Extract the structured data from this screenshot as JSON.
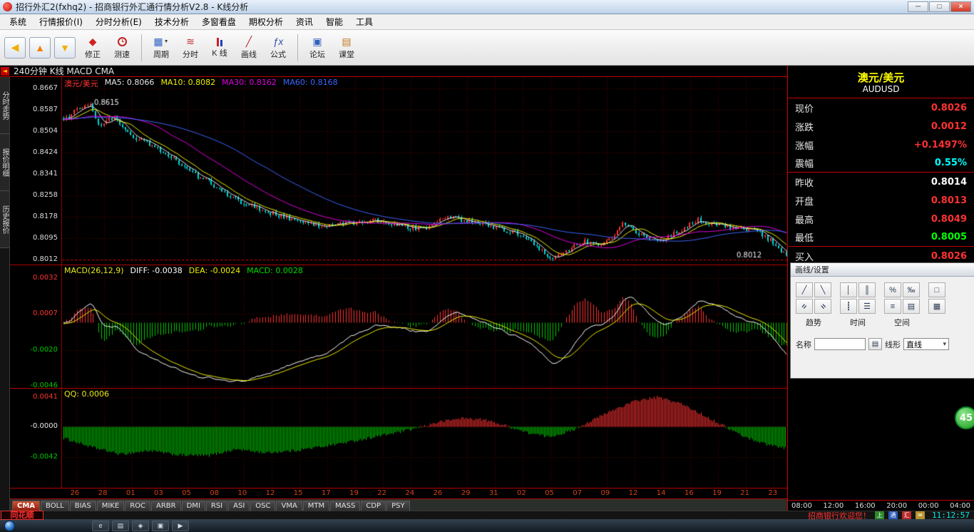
{
  "window": {
    "title": "招行外汇2(fxhq2) - 招商银行外汇通行情分析V2.8 - K线分析",
    "controls": {
      "minimize": "─",
      "restore": "□",
      "close": "×"
    }
  },
  "menu": {
    "items": [
      {
        "key": "system",
        "label": "系统"
      },
      {
        "key": "quotes",
        "label": "行情报价(I)"
      },
      {
        "key": "intraday-analysis",
        "label": "分时分析(E)"
      },
      {
        "key": "technical-analysis",
        "label": "技术分析"
      },
      {
        "key": "multi-window",
        "label": "多窗看盘"
      },
      {
        "key": "options-analysis",
        "label": "期权分析"
      },
      {
        "key": "news",
        "label": "资讯"
      },
      {
        "key": "smart",
        "label": "智能"
      },
      {
        "key": "tools",
        "label": "工具"
      }
    ]
  },
  "toolbar": {
    "correct": "修正",
    "speed": "测速",
    "period": "周期",
    "intraday": "分时",
    "kline": "K 线",
    "draw": "画线",
    "formula": "公式",
    "forum": "论坛",
    "classroom": "课堂"
  },
  "chart_header": {
    "text": "240分钟 K线 MACD CMA"
  },
  "sidebar": {
    "tabs": [
      {
        "key": "intraday-trend",
        "label": "分时走势"
      },
      {
        "key": "quote-detail",
        "label": "报价明细"
      },
      {
        "key": "history-quotes",
        "label": "历史报价"
      }
    ]
  },
  "indicator_tabs": {
    "active": "CMA",
    "items": [
      "CMA",
      "BOLL",
      "BIAS",
      "MIKE",
      "ROC",
      "ARBR",
      "DMI",
      "RSI",
      "ASI",
      "OSC",
      "VMA",
      "MTM",
      "MASS",
      "CDP",
      "PSY"
    ]
  },
  "quote_panel": {
    "title": "澳元/美元",
    "symbol": "AUDUSD",
    "rows": [
      {
        "key": "last",
        "label": "现价",
        "value": "0.8026",
        "color": "#ff3232"
      },
      {
        "key": "change",
        "label": "涨跌",
        "value": "0.0012",
        "color": "#ff3232"
      },
      {
        "key": "change-pct",
        "label": "涨幅",
        "value": "+0.1497%",
        "color": "#ff3232"
      },
      {
        "key": "amplitude",
        "label": "震幅",
        "value": "0.55%",
        "color": "#00ffff",
        "divider": true
      },
      {
        "key": "prev-close",
        "label": "昨收",
        "value": "0.8014",
        "color": "#ffffff"
      },
      {
        "key": "open",
        "label": "开盘",
        "value": "0.8013",
        "color": "#ff3232"
      },
      {
        "key": "high",
        "label": "最高",
        "value": "0.8049",
        "color": "#ff3232"
      },
      {
        "key": "low",
        "label": "最低",
        "value": "0.8005",
        "color": "#00ff00",
        "divider": true
      },
      {
        "key": "bid",
        "label": "买入",
        "value": "0.8026",
        "color": "#ff3232"
      }
    ],
    "time_labels": [
      "08:00",
      "12:00",
      "16:00",
      "20:00",
      "00:00",
      "04:00"
    ]
  },
  "dialog": {
    "title": "画线/设置",
    "gro​ups_note": "",
    "groups": [
      {
        "label": "趋势"
      },
      {
        "label": "时间"
      },
      {
        "label": "空间"
      }
    ],
    "name_label": "名称",
    "linetype_label": "线形",
    "linetype_value": "直线"
  },
  "status_bar": {
    "logo": "同花顺",
    "welcome": "招商银行欢迎您！",
    "time": "11:12:57"
  },
  "badge": {
    "value": "45"
  },
  "chart_data": {
    "type": "candlestick",
    "symbol": "AUDUSD",
    "period": "240分钟",
    "candle_count": 270,
    "y_axis": [
      "0.8667",
      "0.8587",
      "0.8504",
      "0.8424",
      "0.8341",
      "0.8258",
      "0.8178",
      "0.8095",
      "0.8012"
    ],
    "x_axis": [
      "26",
      "28",
      "01",
      "03",
      "05",
      "08",
      "10",
      "12",
      "15",
      "17",
      "19",
      "22",
      "24",
      "26",
      "29",
      "31",
      "02",
      "05",
      "07",
      "09",
      "12",
      "14",
      "16",
      "19",
      "21",
      "23"
    ],
    "price_range": [
      0.8012,
      0.8667
    ],
    "price_path": [
      [
        0,
        0.8545
      ],
      [
        0.02,
        0.8585
      ],
      [
        0.035,
        0.8615
      ],
      [
        0.05,
        0.8525
      ],
      [
        0.07,
        0.8555
      ],
      [
        0.09,
        0.849
      ],
      [
        0.12,
        0.845
      ],
      [
        0.15,
        0.8405
      ],
      [
        0.18,
        0.834
      ],
      [
        0.21,
        0.8295
      ],
      [
        0.24,
        0.824
      ],
      [
        0.27,
        0.8205
      ],
      [
        0.3,
        0.818
      ],
      [
        0.33,
        0.8155
      ],
      [
        0.36,
        0.8135
      ],
      [
        0.4,
        0.8155
      ],
      [
        0.43,
        0.8165
      ],
      [
        0.46,
        0.8145
      ],
      [
        0.5,
        0.8125
      ],
      [
        0.53,
        0.8175
      ],
      [
        0.56,
        0.816
      ],
      [
        0.6,
        0.8135
      ],
      [
        0.63,
        0.811
      ],
      [
        0.655,
        0.806
      ],
      [
        0.675,
        0.801
      ],
      [
        0.7,
        0.8055
      ],
      [
        0.72,
        0.8085
      ],
      [
        0.745,
        0.806
      ],
      [
        0.775,
        0.8155
      ],
      [
        0.8,
        0.8105
      ],
      [
        0.825,
        0.8085
      ],
      [
        0.85,
        0.812
      ],
      [
        0.875,
        0.8165
      ],
      [
        0.9,
        0.8145
      ],
      [
        0.93,
        0.8135
      ],
      [
        0.955,
        0.8125
      ],
      [
        0.98,
        0.808
      ],
      [
        1,
        0.8026
      ]
    ],
    "ma_info": {
      "MA5": "0.8066",
      "MA10": "0.8082",
      "MA30": "0.8162",
      "MA60": "0.8168"
    },
    "macd": {
      "params": "26,12,9",
      "DIFF": "-0.0038",
      "DEA": "-0.0024",
      "MACD": "0.0028",
      "y_labels": [
        "0.0032",
        "0.0007",
        "-0.0020",
        "-0.0046"
      ]
    },
    "qq": {
      "value": "0.0006",
      "y_labels": [
        "0.0041",
        "-0.0000",
        "-0.0042"
      ],
      "path": [
        [
          0,
          -0.0015
        ],
        [
          0.04,
          -0.0028
        ],
        [
          0.08,
          -0.0038
        ],
        [
          0.12,
          -0.0033
        ],
        [
          0.16,
          -0.0039
        ],
        [
          0.2,
          -0.004
        ],
        [
          0.24,
          -0.0031
        ],
        [
          0.28,
          -0.0036
        ],
        [
          0.32,
          -0.0033
        ],
        [
          0.36,
          -0.0027
        ],
        [
          0.4,
          -0.002
        ],
        [
          0.44,
          -0.0012
        ],
        [
          0.48,
          -0.0004
        ],
        [
          0.52,
          0.0007
        ],
        [
          0.55,
          0.0012
        ],
        [
          0.58,
          0.001
        ],
        [
          0.61,
          0.0002
        ],
        [
          0.64,
          -0.0008
        ],
        [
          0.67,
          -0.0014
        ],
        [
          0.7,
          -0.0006
        ],
        [
          0.73,
          0.0009
        ],
        [
          0.76,
          0.0024
        ],
        [
          0.79,
          0.0036
        ],
        [
          0.82,
          0.0041
        ],
        [
          0.85,
          0.0033
        ],
        [
          0.88,
          0.0018
        ],
        [
          0.91,
          0.0002
        ],
        [
          0.94,
          -0.0014
        ],
        [
          0.97,
          -0.0024
        ],
        [
          1,
          -0.003
        ]
      ]
    },
    "annotations": {
      "peak": "0.8615",
      "last": "0.8012"
    },
    "colors": {
      "up": "#ff3232",
      "down": "#00d8d8",
      "ma5": "#e8e8e8",
      "ma10": "#f0f000",
      "ma30": "#e000e0",
      "ma60": "#3c66ff",
      "hist_pos": "#ff3232",
      "hist_neg": "#00c800",
      "diff_line": "#ffffff",
      "dea_line": "#f0f000"
    }
  }
}
